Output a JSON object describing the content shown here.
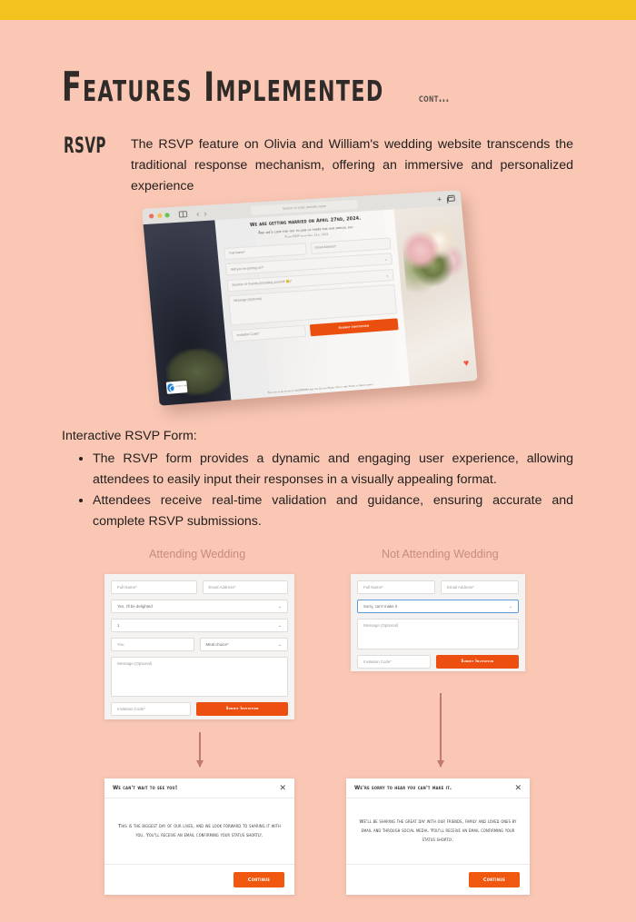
{
  "page": {
    "background_color": "#fac7b5",
    "accent_bar_color": "#f2c21e",
    "brand_orange": "#ec4f0f",
    "caption_color": "#c88b7e",
    "arrow_color": "#c07b6e"
  },
  "heading": {
    "title": "Features Implemented",
    "suffix": "cont..."
  },
  "section": {
    "label": "RSVP",
    "intro": "The RSVP feature on Olivia and William's wedding website transcends the traditional response mechanism, offering an immersive and personalized experience"
  },
  "browser": {
    "url_placeholder": "Search or enter website name",
    "new_tab_label": "+",
    "window_controls": [
      "close-dot",
      "minimize-dot",
      "maximize-dot"
    ],
    "icons": {
      "sidebar": "sidebar-icon",
      "back": "‹",
      "forward": "›",
      "tabs": "tabs-icon",
      "heart": "♥",
      "recaptcha": "recaptcha-badge"
    },
    "recaptcha_label": "reCAPTCHA\nPrivacy - Terms",
    "site": {
      "headline": "We are getting married on April 27nd, 2024.",
      "subheadline": "And we'd love for you to join us there for our special day.",
      "note": "Please RSVP before April 12th, 2024.",
      "fields": {
        "full_name": "Full Name*",
        "email": "Email Address*",
        "attending": "Will you be joining us?*",
        "guests": "Number of Guests (including yourself 😊)*",
        "message": "Message (Optional)",
        "invitation_code": "Invitation Code*"
      },
      "submit_label": "Submit Invitation",
      "legal": "This site is protected by reCAPTCHA and the Google Privacy Policy and Terms of Service apply."
    }
  },
  "content": {
    "lead": "Interactive RSVP Form:",
    "bullets": [
      "The RSVP form provides a dynamic and engaging user experience, allowing attendees to easily input their responses in a visually appealing format.",
      "Attendees receive real-time validation and guidance, ensuring accurate and complete RSVP submissions."
    ]
  },
  "columns": {
    "attending_caption": "Attending Wedding",
    "not_attending_caption": "Not Attending Wedding"
  },
  "attending_form": {
    "full_name": "Full Name*",
    "email": "Email Address*",
    "attendance_value": "Yes, I'll be delighted",
    "guests_value": "1",
    "guest_name": "You",
    "meal_choice": "Meal choice*",
    "message": "Message (Optional)",
    "invitation_code": "Invitation Code*",
    "submit_label": "Submit Invitation",
    "caret": "⌄"
  },
  "not_attending_form": {
    "full_name": "Full Name*",
    "email": "Email Address*",
    "attendance_value": "Sorry, can't make it",
    "message": "Message (Optional)",
    "invitation_code": "Invitation Code*",
    "submit_label": "Submit Invitation",
    "caret": "⌄"
  },
  "attending_modal": {
    "title": "We can't wait to see you!",
    "body": "This is the biggest day of our lives, and we look forward to sharing it with you.\nYou'll receive an email confirming your status shortly.",
    "close_label": "✕",
    "button_label": "Continue"
  },
  "not_attending_modal": {
    "title": "We're sorry to hear you can't make it.",
    "body": "We'll be sharing the great day with our friends, family and loved ones by email and through social media.\nYou'll receive an email confirming your status shortly.",
    "close_label": "✕",
    "button_label": "Continue"
  }
}
